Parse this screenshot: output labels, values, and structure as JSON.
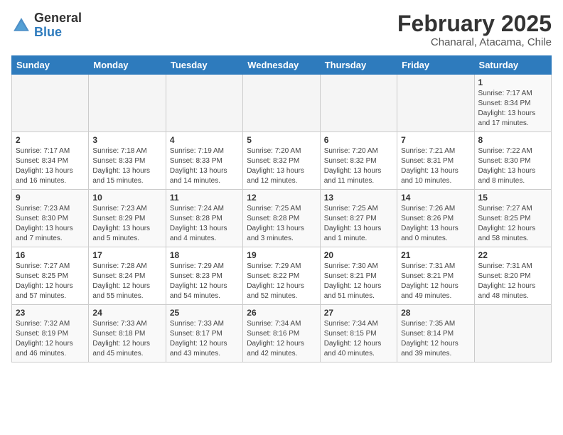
{
  "header": {
    "logo_general": "General",
    "logo_blue": "Blue",
    "month_title": "February 2025",
    "subtitle": "Chanaral, Atacama, Chile"
  },
  "days_of_week": [
    "Sunday",
    "Monday",
    "Tuesday",
    "Wednesday",
    "Thursday",
    "Friday",
    "Saturday"
  ],
  "weeks": [
    [
      {
        "day": "",
        "info": ""
      },
      {
        "day": "",
        "info": ""
      },
      {
        "day": "",
        "info": ""
      },
      {
        "day": "",
        "info": ""
      },
      {
        "day": "",
        "info": ""
      },
      {
        "day": "",
        "info": ""
      },
      {
        "day": "1",
        "info": "Sunrise: 7:17 AM\nSunset: 8:34 PM\nDaylight: 13 hours\nand 17 minutes."
      }
    ],
    [
      {
        "day": "2",
        "info": "Sunrise: 7:17 AM\nSunset: 8:34 PM\nDaylight: 13 hours\nand 16 minutes."
      },
      {
        "day": "3",
        "info": "Sunrise: 7:18 AM\nSunset: 8:33 PM\nDaylight: 13 hours\nand 15 minutes."
      },
      {
        "day": "4",
        "info": "Sunrise: 7:19 AM\nSunset: 8:33 PM\nDaylight: 13 hours\nand 14 minutes."
      },
      {
        "day": "5",
        "info": "Sunrise: 7:20 AM\nSunset: 8:32 PM\nDaylight: 13 hours\nand 12 minutes."
      },
      {
        "day": "6",
        "info": "Sunrise: 7:20 AM\nSunset: 8:32 PM\nDaylight: 13 hours\nand 11 minutes."
      },
      {
        "day": "7",
        "info": "Sunrise: 7:21 AM\nSunset: 8:31 PM\nDaylight: 13 hours\nand 10 minutes."
      },
      {
        "day": "8",
        "info": "Sunrise: 7:22 AM\nSunset: 8:30 PM\nDaylight: 13 hours\nand 8 minutes."
      }
    ],
    [
      {
        "day": "9",
        "info": "Sunrise: 7:23 AM\nSunset: 8:30 PM\nDaylight: 13 hours\nand 7 minutes."
      },
      {
        "day": "10",
        "info": "Sunrise: 7:23 AM\nSunset: 8:29 PM\nDaylight: 13 hours\nand 5 minutes."
      },
      {
        "day": "11",
        "info": "Sunrise: 7:24 AM\nSunset: 8:28 PM\nDaylight: 13 hours\nand 4 minutes."
      },
      {
        "day": "12",
        "info": "Sunrise: 7:25 AM\nSunset: 8:28 PM\nDaylight: 13 hours\nand 3 minutes."
      },
      {
        "day": "13",
        "info": "Sunrise: 7:25 AM\nSunset: 8:27 PM\nDaylight: 13 hours\nand 1 minute."
      },
      {
        "day": "14",
        "info": "Sunrise: 7:26 AM\nSunset: 8:26 PM\nDaylight: 13 hours\nand 0 minutes."
      },
      {
        "day": "15",
        "info": "Sunrise: 7:27 AM\nSunset: 8:25 PM\nDaylight: 12 hours\nand 58 minutes."
      }
    ],
    [
      {
        "day": "16",
        "info": "Sunrise: 7:27 AM\nSunset: 8:25 PM\nDaylight: 12 hours\nand 57 minutes."
      },
      {
        "day": "17",
        "info": "Sunrise: 7:28 AM\nSunset: 8:24 PM\nDaylight: 12 hours\nand 55 minutes."
      },
      {
        "day": "18",
        "info": "Sunrise: 7:29 AM\nSunset: 8:23 PM\nDaylight: 12 hours\nand 54 minutes."
      },
      {
        "day": "19",
        "info": "Sunrise: 7:29 AM\nSunset: 8:22 PM\nDaylight: 12 hours\nand 52 minutes."
      },
      {
        "day": "20",
        "info": "Sunrise: 7:30 AM\nSunset: 8:21 PM\nDaylight: 12 hours\nand 51 minutes."
      },
      {
        "day": "21",
        "info": "Sunrise: 7:31 AM\nSunset: 8:21 PM\nDaylight: 12 hours\nand 49 minutes."
      },
      {
        "day": "22",
        "info": "Sunrise: 7:31 AM\nSunset: 8:20 PM\nDaylight: 12 hours\nand 48 minutes."
      }
    ],
    [
      {
        "day": "23",
        "info": "Sunrise: 7:32 AM\nSunset: 8:19 PM\nDaylight: 12 hours\nand 46 minutes."
      },
      {
        "day": "24",
        "info": "Sunrise: 7:33 AM\nSunset: 8:18 PM\nDaylight: 12 hours\nand 45 minutes."
      },
      {
        "day": "25",
        "info": "Sunrise: 7:33 AM\nSunset: 8:17 PM\nDaylight: 12 hours\nand 43 minutes."
      },
      {
        "day": "26",
        "info": "Sunrise: 7:34 AM\nSunset: 8:16 PM\nDaylight: 12 hours\nand 42 minutes."
      },
      {
        "day": "27",
        "info": "Sunrise: 7:34 AM\nSunset: 8:15 PM\nDaylight: 12 hours\nand 40 minutes."
      },
      {
        "day": "28",
        "info": "Sunrise: 7:35 AM\nSunset: 8:14 PM\nDaylight: 12 hours\nand 39 minutes."
      },
      {
        "day": "",
        "info": ""
      }
    ]
  ]
}
